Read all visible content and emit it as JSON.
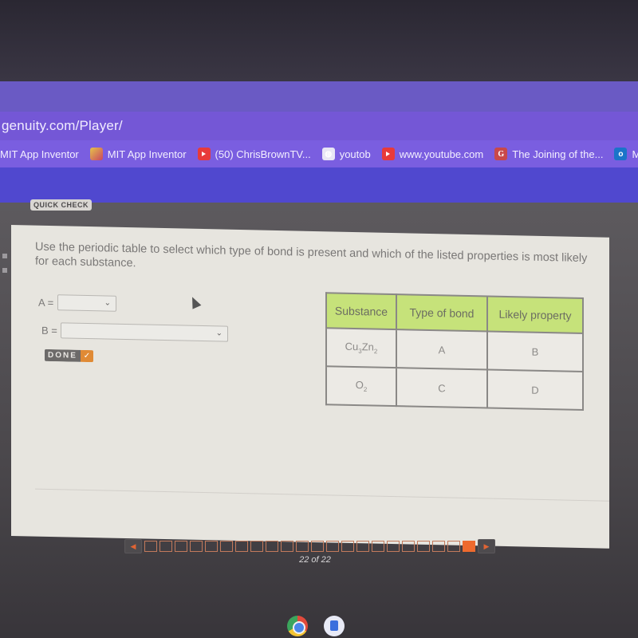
{
  "browser": {
    "url": "genuity.com/Player/",
    "bookmarks": [
      {
        "label": "MIT App Inventor",
        "icon": "none"
      },
      {
        "label": "MIT App Inventor",
        "icon": "mit-app-inventor-icon"
      },
      {
        "label": "(50) ChrisBrownTV...",
        "icon": "youtube-icon"
      },
      {
        "label": "youtob",
        "icon": "globe-icon"
      },
      {
        "label": "www.youtube.com",
        "icon": "youtube-icon"
      },
      {
        "label": "The Joining of the...",
        "icon": "g-icon"
      },
      {
        "label": "Mail -",
        "icon": "outlook-icon"
      }
    ]
  },
  "activity": {
    "badge": "QUICK CHECK",
    "prompt": "Use the periodic table to select which type of bond is present and which of the listed properties is most likely for each substance.",
    "fields": [
      {
        "label": "A =",
        "value": ""
      },
      {
        "label": "B =",
        "value": ""
      }
    ],
    "done_label": "DONE",
    "done_icon": "check-icon",
    "table": {
      "headers": [
        "Substance",
        "Type of bond",
        "Likely property"
      ],
      "rows": [
        {
          "substance_base": "Cu",
          "sub1": "3",
          "mid": "Zn",
          "sub2": "2",
          "bond": "A",
          "property": "B"
        },
        {
          "substance_base": "O",
          "sub1": "2",
          "mid": "",
          "sub2": "",
          "bond": "C",
          "property": "D"
        }
      ]
    }
  },
  "pager": {
    "total": 22,
    "current": 22,
    "label": "22 of 22",
    "prev_icon": "triangle-left",
    "next_icon": "triangle-right"
  },
  "shelf": {
    "apps": [
      "chrome-icon",
      "files-icon"
    ]
  },
  "colors": {
    "header_green": "#c6e27a",
    "accent_orange": "#ee6a2e",
    "browser_purple": "#7457d6"
  }
}
